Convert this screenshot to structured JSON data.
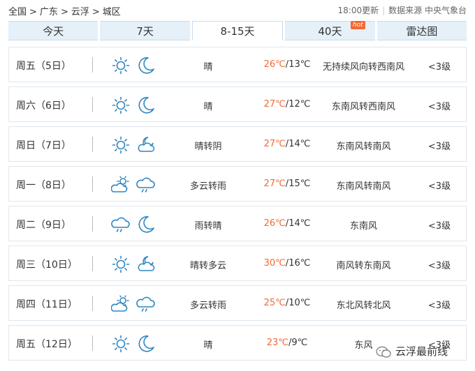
{
  "breadcrumb": [
    "全国",
    "广东",
    "云浮",
    "城区"
  ],
  "breadcrumb_sep": ">",
  "update_time": "18:00更新",
  "source": "数据来源 中央气象台",
  "tabs": [
    {
      "label": "今天",
      "active": false
    },
    {
      "label": "7天",
      "active": false
    },
    {
      "label": "8-15天",
      "active": true
    },
    {
      "label": "40天",
      "active": false,
      "badge": "hot"
    },
    {
      "label": "雷达图",
      "active": false
    }
  ],
  "forecast": [
    {
      "day": "周五（5日）",
      "icon1": "sun-icon",
      "icon2": "moon-icon",
      "condition": "晴",
      "high": "26℃",
      "low": "13℃",
      "wind": "无持续风向转西南风",
      "level": "<3级"
    },
    {
      "day": "周六（6日）",
      "icon1": "sun-icon",
      "icon2": "moon-icon",
      "condition": "晴",
      "high": "27℃",
      "low": "12℃",
      "wind": "东南风转西南风",
      "level": "<3级"
    },
    {
      "day": "周日（7日）",
      "icon1": "sun-icon",
      "icon2": "moon-cloud-icon",
      "condition": "晴转阴",
      "high": "27℃",
      "low": "14℃",
      "wind": "东南风转南风",
      "level": "<3级"
    },
    {
      "day": "周一（8日）",
      "icon1": "sun-cloud-icon",
      "icon2": "rain-cloud-icon",
      "condition": "多云转雨",
      "high": "27℃",
      "low": "15℃",
      "wind": "东南风转南风",
      "level": "<3级"
    },
    {
      "day": "周二（9日）",
      "icon1": "rain-cloud-icon",
      "icon2": "moon-icon",
      "condition": "雨转晴",
      "high": "26℃",
      "low": "14℃",
      "wind": "东南风",
      "level": "<3级"
    },
    {
      "day": "周三（10日）",
      "icon1": "sun-icon",
      "icon2": "moon-cloud-icon",
      "condition": "晴转多云",
      "high": "30℃",
      "low": "16℃",
      "wind": "南风转东南风",
      "level": "<3级"
    },
    {
      "day": "周四（11日）",
      "icon1": "sun-cloud-icon",
      "icon2": "rain-cloud-icon",
      "condition": "多云转雨",
      "high": "25℃",
      "low": "10℃",
      "wind": "东北风转北风",
      "level": "<3级"
    },
    {
      "day": "周五（12日）",
      "icon1": "sun-icon",
      "icon2": "moon-icon",
      "condition": "晴",
      "high": "23℃",
      "low": "9℃",
      "wind": "东风",
      "level": "<3级"
    }
  ],
  "watermark": "云浮最前线",
  "colors": {
    "accent": "#f26a32",
    "icon": "#2e86c1",
    "tab_bg": "#e6f0f8",
    "border": "#dfe7ef"
  }
}
